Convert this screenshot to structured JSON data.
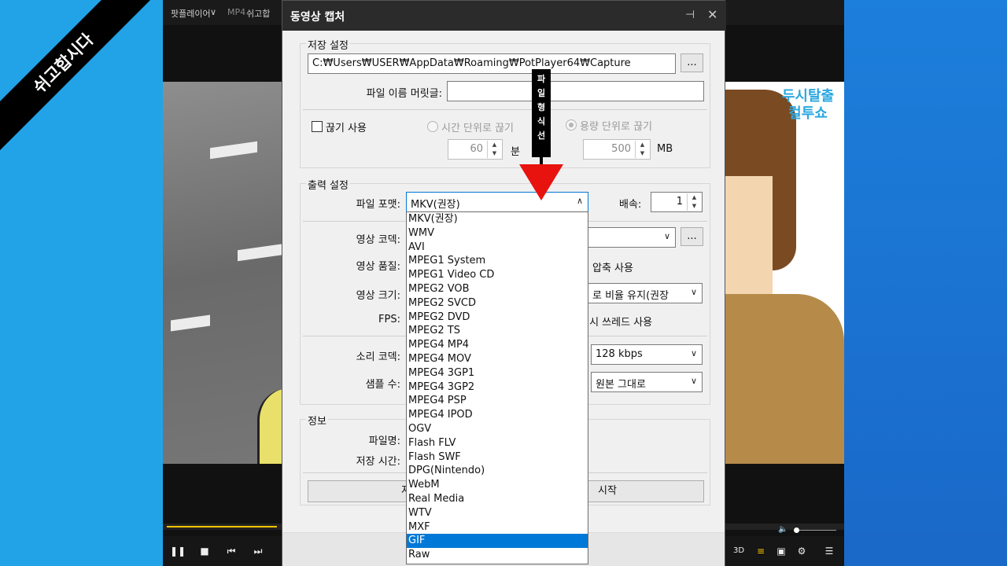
{
  "banner": {
    "text": "쉬고합시다"
  },
  "player": {
    "title_items": [
      "팟플레이어",
      "∨",
      "MP4",
      "쉬고합"
    ],
    "video_right_logo": "두시탈출 컬투쇼",
    "controls": [
      "❚❚",
      "■",
      "⏮",
      "⏭"
    ],
    "right_controls": [
      "3D",
      "≡",
      "▣",
      "⚙",
      "☰"
    ]
  },
  "dialog": {
    "title": "동영상 캡처",
    "pin_icon": "⊣",
    "close_icon": "✕",
    "save": {
      "group_label": "저장 설정",
      "path": "C:₩Users₩USER₩AppData₩Roaming₩PotPlayer64₩Capture",
      "browse_label": "...",
      "prefix_label": "파일 이름 머릿글:",
      "prefix_value": "",
      "split_label": "끊기 사용",
      "split_time_label": "시간 단위로 끊기",
      "split_size_label": "용량 단위로 끊기",
      "time_value": "60",
      "time_unit": "분",
      "size_value": "500",
      "size_unit": "MB"
    },
    "output": {
      "group_label": "출력 설정",
      "format_label": "파일 포맷:",
      "format_value": "MKV(권장)",
      "speed_label": "배속:",
      "speed_value": "1",
      "video_codec_label": "영상 코덱:",
      "video_quality_label": "영상 품질:",
      "compress_label": "압축 사용",
      "video_size_label": "영상 크기:",
      "video_size_value": "로 비율 유지(권장",
      "fps_label": "FPS:",
      "thread_label": "축 시 쓰레드 사용",
      "audio_codec_label": "소리 코덱:",
      "audio_codec_value": "128 kbps",
      "sample_label": "샘플 수:",
      "sample_value": "원본 그대로"
    },
    "info": {
      "group_label": "정보",
      "filename_label": "파일명:",
      "time_label": "저장 시간:",
      "save_folder_label": "저장 폴",
      "start_label": "시작"
    }
  },
  "dropdown": {
    "items": [
      "MKV(권장)",
      "WMV",
      "AVI",
      "MPEG1 System",
      "MPEG1 Video CD",
      "MPEG2 VOB",
      "MPEG2 SVCD",
      "MPEG2 DVD",
      "MPEG2 TS",
      "MPEG4 MP4",
      "MPEG4 MOV",
      "MPEG4 3GP1",
      "MPEG4 3GP2",
      "MPEG4 PSP",
      "MPEG4 IPOD",
      "OGV",
      "Flash FLV",
      "Flash SWF",
      "DPG(Nintendo)",
      "WebM",
      "Real Media",
      "WTV",
      "MXF",
      "GIF",
      "Raw"
    ],
    "selected": "GIF"
  },
  "annotation": {
    "chars": [
      "파",
      "일",
      "형",
      "식",
      "선"
    ]
  },
  "colors": {
    "selection": "#0078d7",
    "arrow": "#e8120e",
    "accent": "#f5c400"
  }
}
